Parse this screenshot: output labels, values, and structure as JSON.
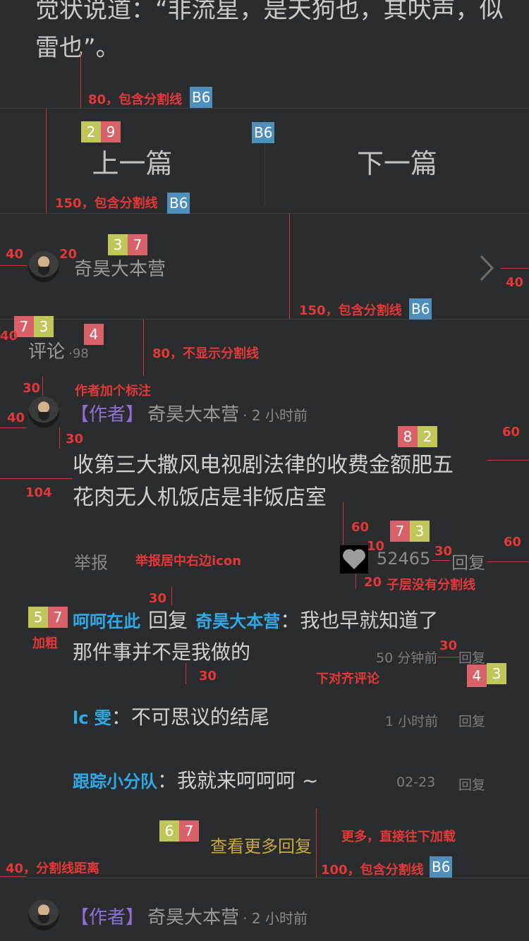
{
  "article": {
    "line1": "觉状说道：“非流星，是天狗也，其吠声，似",
    "line2": "雷也”。"
  },
  "nav": {
    "prev_label": "上一篇",
    "next_label": "下一篇"
  },
  "author": {
    "name": "奇昊大本营"
  },
  "comments_header": {
    "label": "评论",
    "count": "·98"
  },
  "main_comment": {
    "tag": "【作者】",
    "name": "奇昊大本营",
    "time": "· 2 小时前",
    "text_line1": "收第三大撒风电视剧法律的收费金额肥五",
    "text_line2": "花肉无人机饭店是非饭店室",
    "report_label": "举报",
    "likes": "52465",
    "reply_label": "回复"
  },
  "replies": [
    {
      "user": "呵呵在此",
      "mid": "回复",
      "target": "奇昊大本营",
      "colon": "：",
      "text_line1": "我也早就知道了",
      "text_line2": "那件事并不是我做的",
      "time": "50 分钟前",
      "reply_label": "回复"
    },
    {
      "user": "lc 雯",
      "colon": "：",
      "text": "不可思议的结尾",
      "time": "1 小时前",
      "reply_label": "回复"
    },
    {
      "user": "跟踪小分队",
      "colon": "：",
      "text": "我就来呵呵呵 ~",
      "time": "02-23",
      "reply_label": "回复"
    }
  ],
  "more_replies_label": "查看更多回复",
  "bottom_comment": {
    "tag": "【作者】",
    "name": "奇昊大本营",
    "time": "· 2 小时前"
  },
  "annotations": {
    "a1": "80，包含分割线",
    "a2": "150，包含分割线",
    "a3": "150，包含分割线",
    "a4": "80，不显示分割线",
    "a5": "作者加个标注",
    "a6": "举报居中右边icon",
    "a7": "子层没有分割线",
    "a8": "加粗",
    "a9": "下对齐评论",
    "a10": "更多，直接往下加载",
    "a11": "40，分割线距离",
    "a12": "100，包含分割线",
    "b6": "B6",
    "n40": "40",
    "n20": "20",
    "n30": "30",
    "n60": "60",
    "n104": "104",
    "n10": "10",
    "n100": "100"
  },
  "badges": {
    "b29": [
      "2",
      "9"
    ],
    "b37a": [
      "3",
      "7"
    ],
    "b73a": [
      "7",
      "3"
    ],
    "b4": [
      "4"
    ],
    "b82": [
      "8",
      "2"
    ],
    "b73b": [
      "7",
      "3"
    ],
    "b57": [
      "5",
      "7"
    ],
    "b43": [
      "4",
      "3"
    ],
    "b67": [
      "6",
      "7"
    ]
  },
  "colors": {
    "background": "#2b2c2e",
    "text": "#c9c9c9",
    "author_tag": "#8e6fd8",
    "username_blue": "#2fa9e6",
    "more_yellow": "#c7a93a",
    "annotation_red": "#e23838"
  }
}
